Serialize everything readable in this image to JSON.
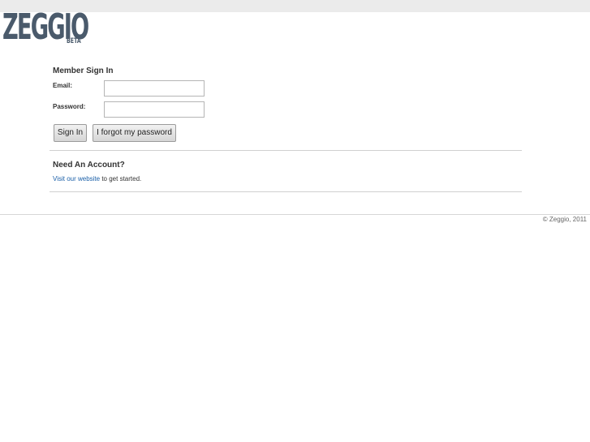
{
  "brand": {
    "name": "ZEGGIO",
    "tag": "BETA"
  },
  "signin": {
    "heading": "Member Sign In",
    "email_label": "Email:",
    "email_value": "",
    "password_label": "Password:",
    "password_value": "",
    "signin_label": "Sign In",
    "forgot_label": "I forgot my password"
  },
  "account": {
    "heading": "Need An Account?",
    "link_text": "Visit our website",
    "after_link_text": " to get started."
  },
  "footer": {
    "copyright": "© Zeggio, 2011"
  },
  "colors": {
    "link": "#1a5fa8",
    "logo": "#4a5a6b",
    "topbar": "#ebebeb"
  }
}
